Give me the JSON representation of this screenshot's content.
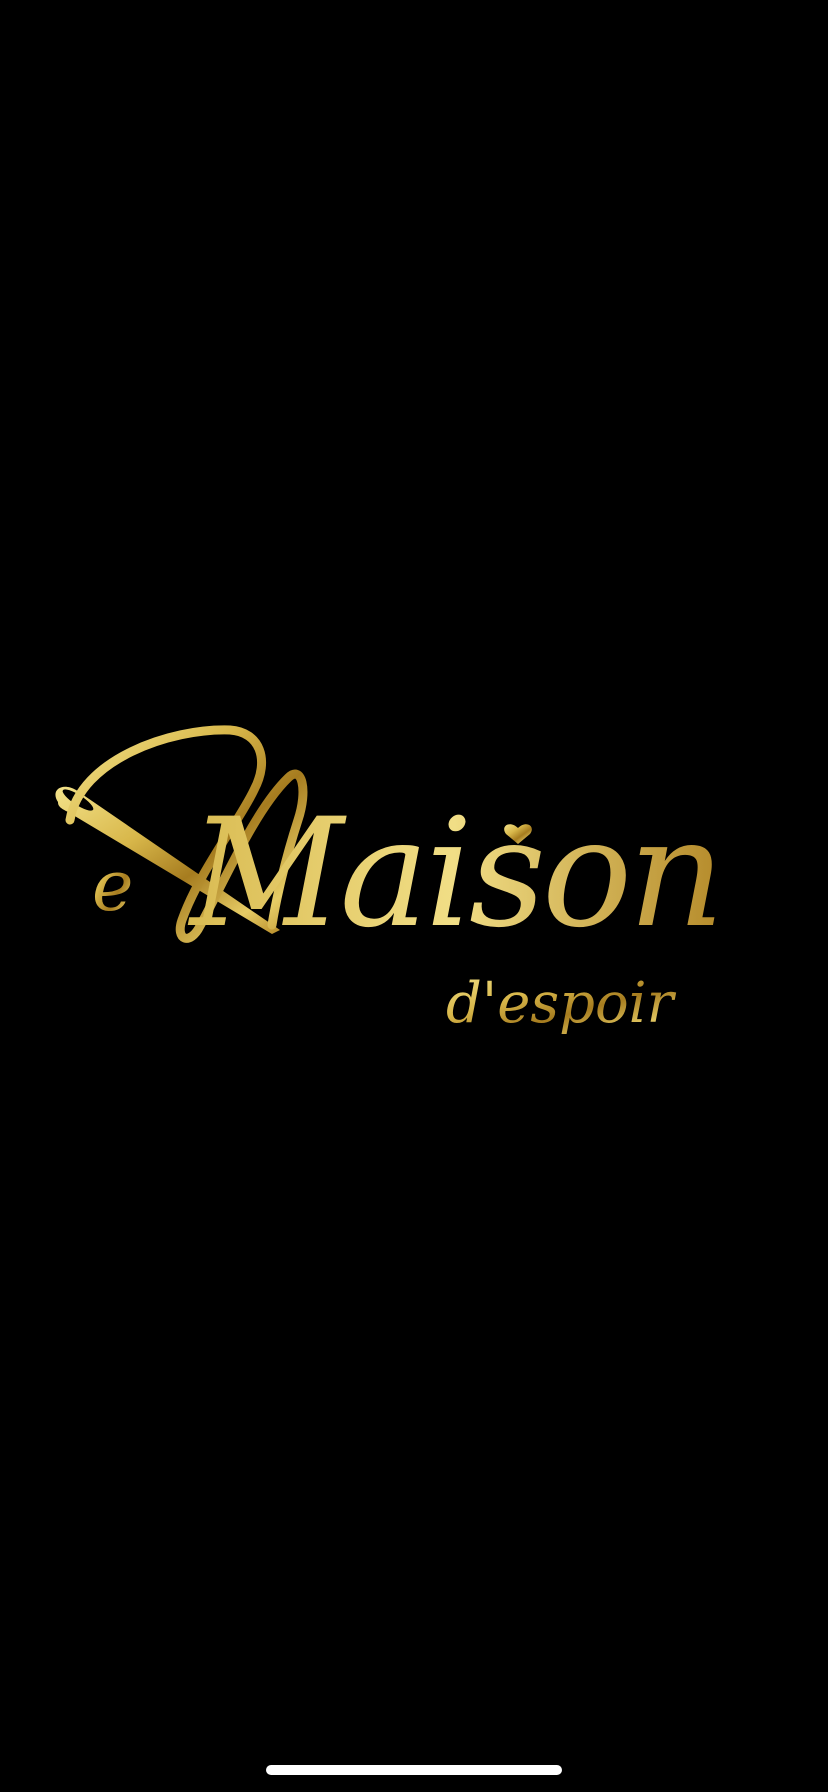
{
  "splash": {
    "brand_logo": {
      "wordmark_lead": "e",
      "wordmark_main": "Maison",
      "wordmark_sub": "d'espoir",
      "icon": "sewing-needle-icon",
      "accent_icon": "heart-icon"
    }
  },
  "colors": {
    "background": "#000000",
    "gold_light": "#f3e38a",
    "gold_mid": "#d8b74a",
    "gold_dark": "#a67c1f",
    "home_indicator": "#ffffff"
  }
}
